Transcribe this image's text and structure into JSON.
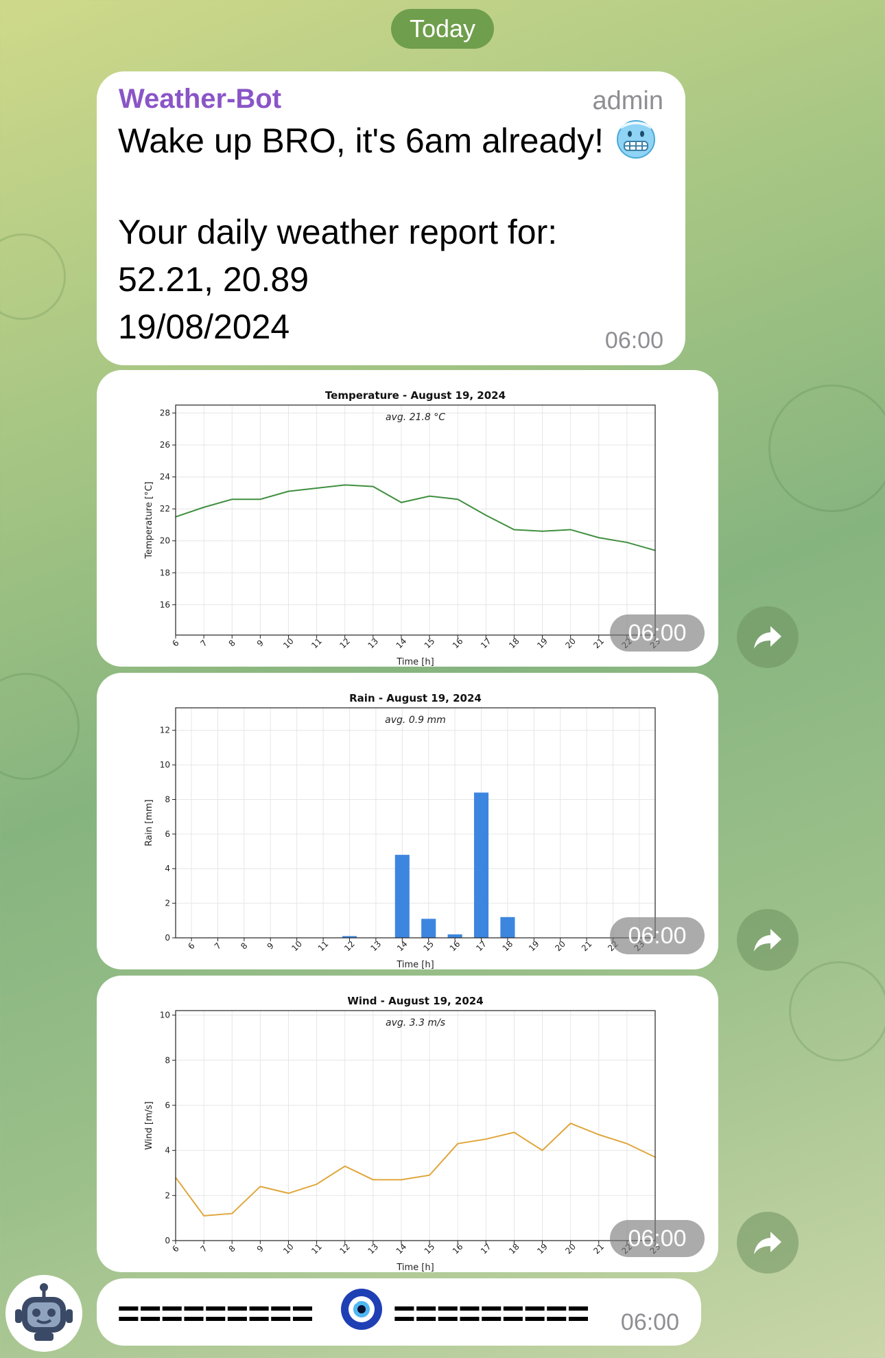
{
  "date_label": "Today",
  "message": {
    "sender": "Weather-Bot",
    "role": "admin",
    "line1": "Wake up BRO, it's 6am already!",
    "line2": "Your daily weather report for:",
    "line3": "52.21, 20.89",
    "line4": "19/08/2024",
    "time": "06:00"
  },
  "charts": [
    {
      "time": "06:00"
    },
    {
      "time": "06:00"
    },
    {
      "time": "06:00"
    }
  ],
  "footer": {
    "left": "=========",
    "right": "=========",
    "time": "06:00"
  },
  "chart_data": [
    {
      "type": "line",
      "title": "Temperature - August 19, 2024",
      "annotation": "avg. 21.8 °C",
      "xlabel": "Time [h]",
      "ylabel": "Temperature [°C]",
      "x": [
        6,
        7,
        8,
        9,
        10,
        11,
        12,
        13,
        14,
        15,
        16,
        17,
        18,
        19,
        20,
        21,
        22,
        23
      ],
      "values": [
        21.5,
        22.1,
        22.6,
        22.6,
        23.1,
        23.3,
        23.5,
        23.4,
        22.4,
        22.8,
        22.6,
        21.6,
        20.7,
        20.6,
        20.7,
        20.2,
        19.9,
        19.4
      ],
      "ylim": [
        14.1,
        28.5
      ],
      "yticks": [
        16,
        18,
        20,
        22,
        24,
        26,
        28
      ],
      "color": "#3f8f3f",
      "grid": true
    },
    {
      "type": "bar",
      "title": "Rain - August 19, 2024",
      "annotation": "avg. 0.9 mm",
      "xlabel": "Time [h]",
      "ylabel": "Rain [mm]",
      "x": [
        6,
        7,
        8,
        9,
        10,
        11,
        12,
        13,
        14,
        15,
        16,
        17,
        18,
        19,
        20,
        21,
        22,
        23
      ],
      "values": [
        0,
        0,
        0,
        0,
        0,
        0,
        0.1,
        0,
        4.8,
        1.1,
        0.2,
        8.4,
        1.2,
        0,
        0,
        0,
        0,
        0
      ],
      "ylim": [
        0,
        13.3
      ],
      "yticks": [
        0,
        2,
        4,
        6,
        8,
        10,
        12
      ],
      "color": "#3d86e0",
      "grid": true
    },
    {
      "type": "line",
      "title": "Wind - August 19, 2024",
      "annotation": "avg. 3.3 m/s",
      "xlabel": "Time [h]",
      "ylabel": "Wind [m/s]",
      "x": [
        6,
        7,
        8,
        9,
        10,
        11,
        12,
        13,
        14,
        15,
        16,
        17,
        18,
        19,
        20,
        21,
        22,
        23
      ],
      "values": [
        2.8,
        1.1,
        1.2,
        2.4,
        2.1,
        2.5,
        3.3,
        2.7,
        2.7,
        2.9,
        4.3,
        4.5,
        4.8,
        4.0,
        5.2,
        4.7,
        4.3,
        3.7
      ],
      "ylim": [
        0,
        10.2
      ],
      "yticks": [
        0,
        2,
        4,
        6,
        8,
        10
      ],
      "color": "#e0a63b",
      "grid": true
    }
  ]
}
